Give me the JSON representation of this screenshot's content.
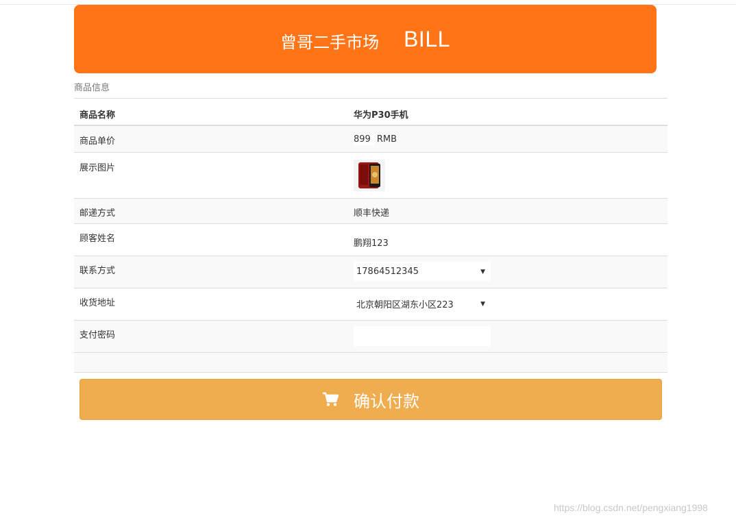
{
  "header": {
    "market_title": "曾哥二手市场",
    "bill_label": "BILL",
    "brand_color": "#ff7417"
  },
  "section_caption": "商品信息",
  "product": {
    "name_label": "商品名称",
    "name_value": "华为P30手机",
    "price_label": "商品单价",
    "price_value": "899",
    "price_unit": "RMB",
    "image_label": "展示图片",
    "image_icon": "phone-thumbnail-icon",
    "shipping_label": "邮递方式",
    "shipping_value": "顺丰快递",
    "customer_label": "顾客姓名",
    "customer_value": "鹏翔123",
    "contact_label": "联系方式",
    "contact_value": "17864512345",
    "address_label": "收货地址",
    "address_value": "北京朝阳区湖东小区223",
    "password_label": "支付密码",
    "password_value": ""
  },
  "confirm_button": {
    "label": "确认付款",
    "icon": "shopping-cart-icon",
    "color": "#efad4f"
  },
  "watermark": "https://blog.csdn.net/pengxiang1998"
}
